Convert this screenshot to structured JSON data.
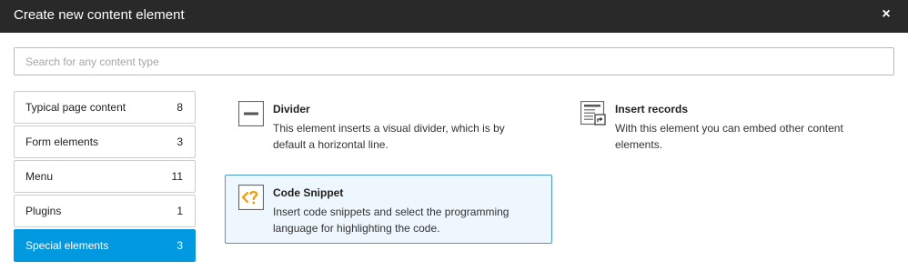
{
  "modal": {
    "title": "Create new content element",
    "close_icon": "close-icon",
    "close_label": "×"
  },
  "search": {
    "value": "",
    "placeholder": "Search for any content type"
  },
  "categories": [
    {
      "label": "Typical page content",
      "count": "8",
      "active": false
    },
    {
      "label": "Form elements",
      "count": "3",
      "active": false
    },
    {
      "label": "Menu",
      "count": "11",
      "active": false
    },
    {
      "label": "Plugins",
      "count": "1",
      "active": false
    },
    {
      "label": "Special elements",
      "count": "3",
      "active": true
    }
  ],
  "elements": [
    {
      "title": "Divider",
      "description": "This element inserts a visual divider, which is by default a horizontal line.",
      "icon": "divider-icon",
      "selected": false
    },
    {
      "title": "Insert records",
      "description": "With this element you can embed other content elements.",
      "icon": "insert-records-icon",
      "selected": false
    },
    {
      "title": "Code Snippet",
      "description": "Insert code snippets and select the programming language for highlighting the code.",
      "icon": "code-snippet-icon",
      "selected": true
    }
  ],
  "colors": {
    "header_bg": "#292929",
    "active_tab": "#0099e0",
    "selected_item_bg": "#eef7fd",
    "selected_item_border": "#4a9bc8",
    "code_icon_accent": "#f49700"
  }
}
